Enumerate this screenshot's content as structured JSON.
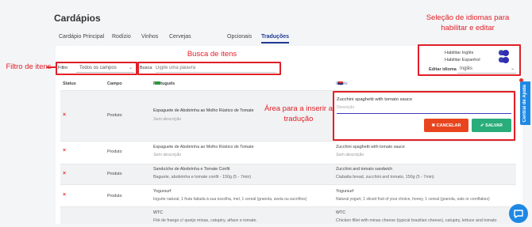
{
  "page": {
    "title": "Cardápios"
  },
  "tabs": [
    {
      "label": "Cardápio Principal"
    },
    {
      "label": "Rodízio"
    },
    {
      "label": "Vinhos"
    },
    {
      "label": "Cervejas"
    },
    {
      "label": "Opcionais"
    },
    {
      "label": "Traduções",
      "active": true
    }
  ],
  "filter": {
    "label": "Filtro",
    "value": "Todos os campos"
  },
  "search": {
    "label": "Busca",
    "placeholder": "Digite uma palavra"
  },
  "languages": {
    "enable_english": "Habilitar Inglês",
    "enable_spanish": "Habilitar Espanhol",
    "edit_label": "Editar idioma",
    "edit_value": "Inglês"
  },
  "table": {
    "headers": {
      "status": "Status",
      "field": "Campo",
      "portuguese": "Português",
      "english": "Inglês"
    },
    "rows": [
      {
        "field": "Produto",
        "pt_title": "Espaguete de Abobrinha ao Molho Rústico de Tomate",
        "pt_sub": "Sem descrição",
        "en_title": "",
        "en_sub": ""
      },
      {
        "field": "Produto",
        "pt_title": "Espaguete de Abobrinha ao Molho Rústico de Tomate",
        "pt_sub": "Sem descrição",
        "en_title": "Zucchini spaghetti with tomato sauce",
        "en_sub": "Sem descrição"
      },
      {
        "field": "Produto",
        "pt_title": "Sanduíche de Abobrinha e Tomate Confit",
        "pt_sub": "Baguete, abobrinha e tomate confit - 150g (5 - 7min)",
        "en_title": "Zucchini and tomato sandwich",
        "en_sub": "Ciabatta bread, zucchini and tomato, 150g (5 - 7min)"
      },
      {
        "field": "Produto",
        "pt_title": "Yogursurf",
        "pt_sub": "Iogurte natural, 1 fruta fatiada à sua escolha, mel, 1 cereal (granola, aveia ou sucrilhos)",
        "en_title": "Yogursurf",
        "en_sub": "Natural yogurt, 1 sliced fruit of your choice, honey, 1 cereal (granola, oats or cornflakes)"
      },
      {
        "field": "Produto",
        "pt_title": "WTC",
        "pt_sub": "Filé de frango c/ queijo minas, catupiry, alface e tomate.",
        "en_title": "WTC",
        "en_sub": "Chicken fillet with minas cheese (typical brazilian cheese), catupiry, lettuce and tomato"
      }
    ]
  },
  "editor": {
    "text": "Zucchini spaghetti with tomato sauce",
    "desc_placeholder": "Descrição",
    "cancel": "CANCELAR",
    "save": "SALVAR"
  },
  "help_tab": "Central de Ajuda",
  "annotations": {
    "languages": "Seleção de idiomas para habilitar e editar",
    "filter": "Filtro de itens",
    "search": "Busca de itens",
    "editor": "Área para a inserir a tradução"
  },
  "colors": {
    "accent": "#1f3a93",
    "annotation": "#e12028",
    "cancel": "#e8451e",
    "save": "#29ad7a",
    "help": "#1e88e5"
  }
}
